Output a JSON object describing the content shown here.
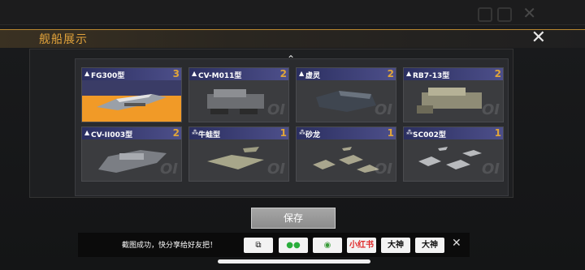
{
  "window": {
    "title": "舰船展示",
    "close_icon": "close-icon"
  },
  "grid": {
    "cards": [
      {
        "name": "FG300型",
        "count": "3",
        "selected": true
      },
      {
        "name": "CV-M011型",
        "count": "2",
        "selected": false
      },
      {
        "name": "虚灵",
        "count": "2",
        "selected": false
      },
      {
        "name": "RB7-13型",
        "count": "2",
        "selected": false
      },
      {
        "name": "CV-II003型",
        "count": "2",
        "selected": false
      },
      {
        "name": "牛蛙型",
        "count": "1",
        "selected": false
      },
      {
        "name": "砂龙",
        "count": "1",
        "selected": false
      },
      {
        "name": "SC002型",
        "count": "1",
        "selected": false
      }
    ]
  },
  "actions": {
    "save_label": "保存"
  },
  "share_bar": {
    "message": "截图成功，快分享给好友把！",
    "buttons": [
      {
        "label": "",
        "icon": "screen-icon"
      },
      {
        "label": "",
        "icon": "wechat-icon"
      },
      {
        "label": "",
        "icon": "moments-icon"
      },
      {
        "label": "小红书",
        "icon": "xiaohongshu-logo"
      },
      {
        "label": "大神",
        "icon": "dashen-logo"
      },
      {
        "label": "大神",
        "icon": "dashen-games-logo"
      }
    ]
  },
  "colors": {
    "accent": "#e2a33b",
    "selected": "#f19a27",
    "card_header": "#3a3c66"
  }
}
